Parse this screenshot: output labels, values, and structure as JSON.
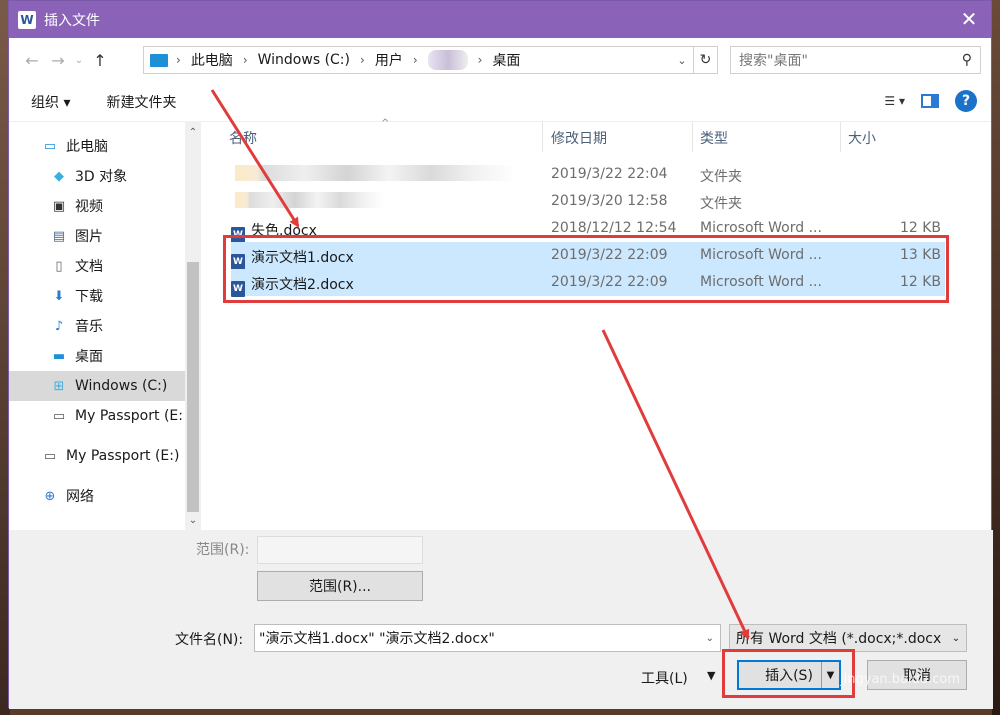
{
  "window": {
    "title": "插入文件",
    "app_icon": "W"
  },
  "nav": {
    "crumbs": [
      "此电脑",
      "Windows (C:)",
      "用户",
      "桌面"
    ],
    "search_placeholder": "搜索\"桌面\""
  },
  "toolbar": {
    "organize": "组织 ▾",
    "new_folder": "新建文件夹"
  },
  "sidebar": {
    "items": [
      {
        "label": "此电脑",
        "icon": "computer-icon"
      },
      {
        "label": "3D 对象",
        "icon": "cube-icon"
      },
      {
        "label": "视频",
        "icon": "video-icon"
      },
      {
        "label": "图片",
        "icon": "picture-icon"
      },
      {
        "label": "文档",
        "icon": "document-icon"
      },
      {
        "label": "下载",
        "icon": "download-icon"
      },
      {
        "label": "音乐",
        "icon": "music-icon"
      },
      {
        "label": "桌面",
        "icon": "desktop-icon"
      },
      {
        "label": "Windows (C:)",
        "icon": "drive-icon"
      },
      {
        "label": "My Passport (E:",
        "icon": "usb-drive-icon"
      },
      {
        "label": "My Passport (E:)",
        "icon": "usb-drive-icon"
      },
      {
        "label": "网络",
        "icon": "network-icon"
      }
    ]
  },
  "columns": {
    "name": "名称",
    "date": "修改日期",
    "type": "类型",
    "size": "大小"
  },
  "files": [
    {
      "name": "",
      "date": "2019/3/22 22:04",
      "type": "文件夹",
      "size": ""
    },
    {
      "name": "",
      "date": "2019/3/20 12:58",
      "type": "文件夹",
      "size": ""
    },
    {
      "name": "失色.docx",
      "date": "2018/12/12 12:54",
      "type": "Microsoft Word ...",
      "size": "12 KB"
    },
    {
      "name": "演示文档1.docx",
      "date": "2019/3/22 22:09",
      "type": "Microsoft Word ...",
      "size": "13 KB"
    },
    {
      "name": "演示文档2.docx",
      "date": "2019/3/22 22:09",
      "type": "Microsoft Word ...",
      "size": "12 KB"
    }
  ],
  "bottom": {
    "range_label": "范围(R):",
    "range_button": "范围(R)...",
    "filename_label": "文件名(N):",
    "filename_value": "\"演示文档1.docx\" \"演示文档2.docx\"",
    "filetype_value": "所有 Word 文档 (*.docx;*.docx",
    "tools_label": "工具(L)",
    "insert_label": "插入(S)",
    "cancel_label": "取消"
  },
  "watermark": "jingyan.baidu.com",
  "colors": {
    "titlebar": "#8a63b8",
    "selection": "#cce8ff",
    "annotation": "#e03c3c"
  }
}
